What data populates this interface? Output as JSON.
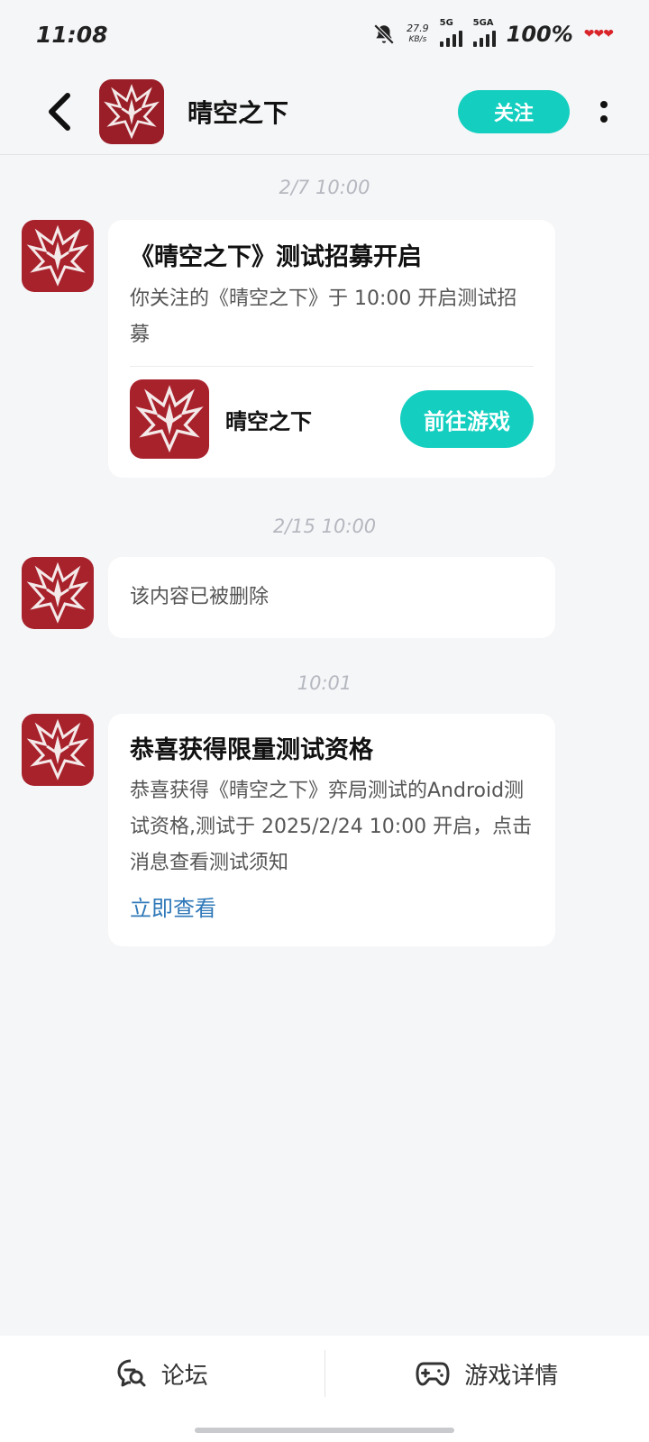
{
  "status_bar": {
    "time": "11:08",
    "net_speed": "27.9",
    "net_unit": "KB/s",
    "signal1_label": "5G",
    "signal2_label": "5GA",
    "battery": "100%",
    "hearts": "❤❤❤"
  },
  "header": {
    "title": "晴空之下",
    "follow_label": "关注",
    "icons": [
      "back-arrow-icon",
      "more-vertical-icon"
    ]
  },
  "messages": [
    {
      "time": "2/7   10:00",
      "title": "《晴空之下》测试招募开启",
      "body": "你关注的《晴空之下》于 10:00 开启测试招募",
      "game_name": "晴空之下",
      "button_label": "前往游戏"
    },
    {
      "time": "2/15   10:00",
      "body": "该内容已被删除"
    },
    {
      "time": "10:01",
      "title": "恭喜获得限量测试资格",
      "body": "恭喜获得《晴空之下》弈局测试的Android测试资格,测试于 2025/2/24 10:00 开启，点击消息查看测试须知",
      "link_label": "立即查看"
    }
  ],
  "bottom_tabs": [
    {
      "label": "论坛",
      "icon": "forum-search-icon"
    },
    {
      "label": "游戏详情",
      "icon": "gamepad-icon"
    }
  ],
  "colors": {
    "accent": "#14cfc0",
    "link": "#2f78b8",
    "logo_red": "#a8222c",
    "background": "#f5f6f8"
  }
}
